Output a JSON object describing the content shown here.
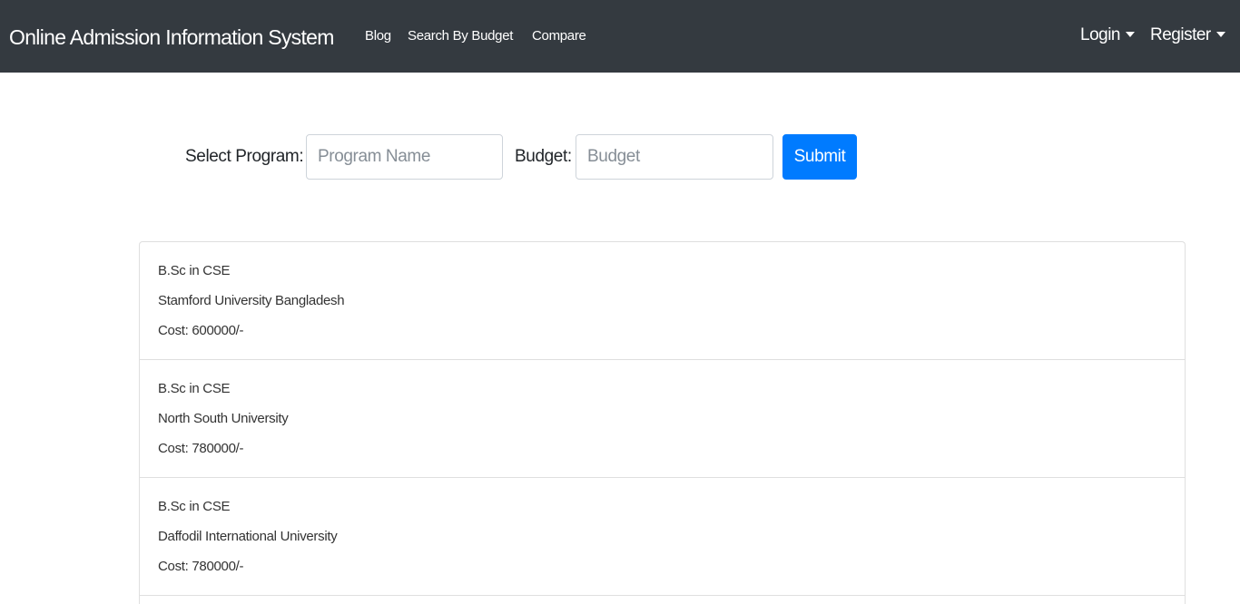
{
  "navbar": {
    "brand": "Online Admission Information System",
    "links": [
      "Blog",
      "Search By Budget",
      "Compare"
    ],
    "login_label": "Login",
    "register_label": "Register"
  },
  "search_form": {
    "program_label": "Select Program:",
    "program_placeholder": "Program Name",
    "program_value": "",
    "budget_label": "Budget:",
    "budget_placeholder": "Budget",
    "budget_value": "",
    "submit_label": "Submit"
  },
  "results": [
    {
      "program": "B.Sc in CSE",
      "university": "Stamford University Bangladesh",
      "cost": "Cost: 600000/-"
    },
    {
      "program": "B.Sc in CSE",
      "university": "North South University",
      "cost": "Cost: 780000/-"
    },
    {
      "program": "B.Sc in CSE",
      "university": "Daffodil International University",
      "cost": "Cost: 780000/-"
    }
  ],
  "colors": {
    "navbar_bg": "#343a40",
    "primary": "#007bff"
  }
}
